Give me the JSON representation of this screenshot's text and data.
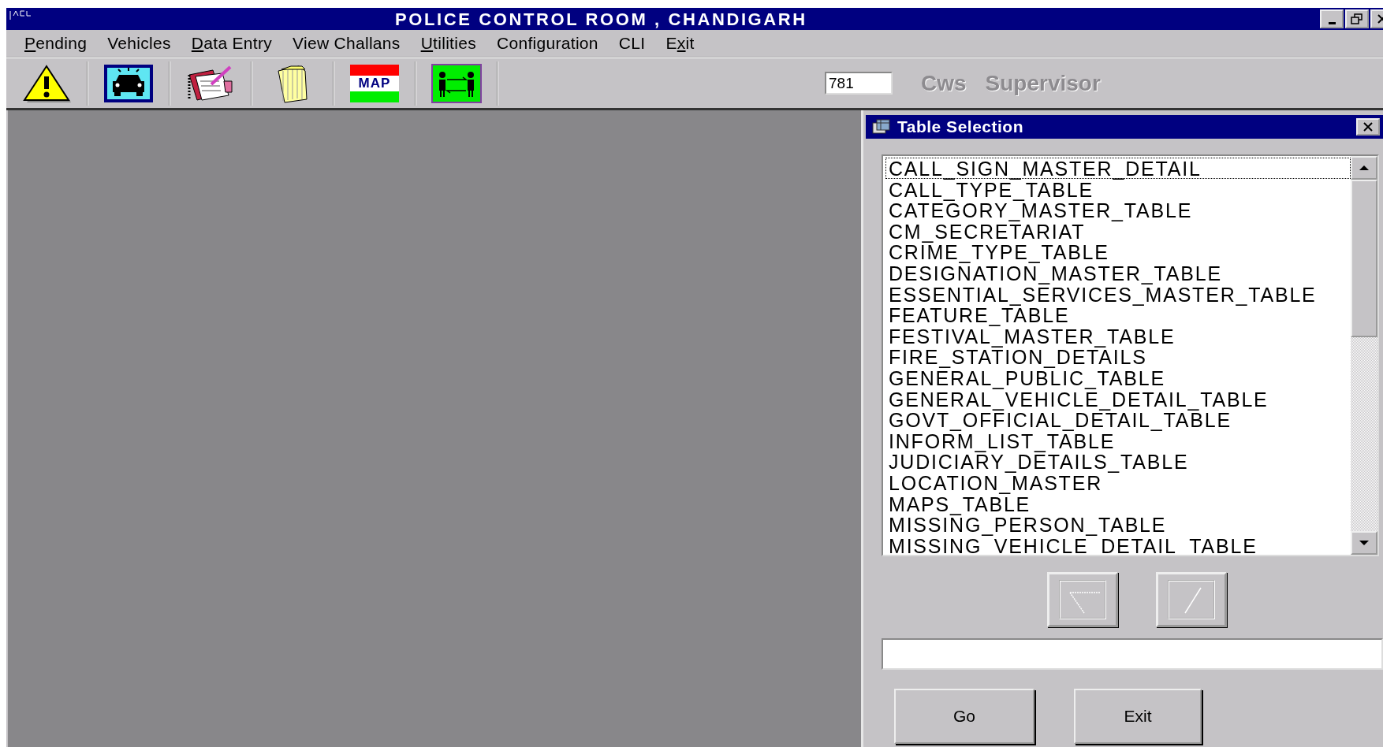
{
  "window": {
    "title": "POLICE CONTROL ROOM , CHANDIGARH"
  },
  "menu": [
    {
      "parts": [
        {
          "text": "P",
          "underlined": true
        },
        {
          "text": "ending",
          "underlined": false
        }
      ]
    },
    {
      "parts": [
        {
          "text": "Vehicles",
          "underlined": false
        }
      ]
    },
    {
      "parts": [
        {
          "text": "D",
          "underlined": true
        },
        {
          "text": "ata Entry",
          "underlined": false
        }
      ]
    },
    {
      "parts": [
        {
          "text": "View Challans",
          "underlined": false
        }
      ]
    },
    {
      "parts": [
        {
          "text": "U",
          "underlined": true
        },
        {
          "text": "tilities",
          "underlined": false
        }
      ]
    },
    {
      "parts": [
        {
          "text": "Configuration",
          "underlined": false
        }
      ]
    },
    {
      "parts": [
        {
          "text": "CLI",
          "underlined": false
        }
      ]
    },
    {
      "parts": [
        {
          "text": "E",
          "underlined": false
        },
        {
          "text": "x",
          "underlined": true
        },
        {
          "text": "it",
          "underlined": false
        }
      ]
    }
  ],
  "toolbar": {
    "buttons": [
      {
        "kind": "warning"
      },
      {
        "kind": "vehicle"
      },
      {
        "kind": "notebook"
      },
      {
        "kind": "files"
      },
      {
        "kind": "map",
        "label": "MAP"
      },
      {
        "kind": "transfer"
      }
    ],
    "code_field": {
      "value": "781"
    },
    "labels": [
      "Cws",
      "Supervisor"
    ]
  },
  "dialog": {
    "title": "Table Selection",
    "tables": [
      {
        "label": "CALL_SIGN_MASTER_DETAIL",
        "selected": true
      },
      {
        "label": "CALL_TYPE_TABLE",
        "selected": false
      },
      {
        "label": "CATEGORY_MASTER_TABLE",
        "selected": false
      },
      {
        "label": "CM_SECRETARIAT",
        "selected": false
      },
      {
        "label": "CRIME_TYPE_TABLE",
        "selected": false
      },
      {
        "label": "DESIGNATION_MASTER_TABLE",
        "selected": false
      },
      {
        "label": "ESSENTIAL_SERVICES_MASTER_TABLE",
        "selected": false
      },
      {
        "label": "FEATURE_TABLE",
        "selected": false
      },
      {
        "label": "FESTIVAL_MASTER_TABLE",
        "selected": false
      },
      {
        "label": "FIRE_STATION_DETAILS",
        "selected": false
      },
      {
        "label": "GENERAL_PUBLIC_TABLE",
        "selected": false
      },
      {
        "label": "GENERAL_VEHICLE_DETAIL_TABLE",
        "selected": false
      },
      {
        "label": "GOVT_OFFICIAL_DETAIL_TABLE",
        "selected": false
      },
      {
        "label": "INFORM_LIST_TABLE",
        "selected": false
      },
      {
        "label": "JUDICIARY_DETAILS_TABLE",
        "selected": false
      },
      {
        "label": "LOCATION_MASTER",
        "selected": false
      },
      {
        "label": "MAPS_TABLE",
        "selected": false
      },
      {
        "label": "MISSING_PERSON_TABLE",
        "selected": false
      },
      {
        "label": "MISSING_VEHICLE_DETAIL_TABLE",
        "selected": false
      }
    ],
    "buttons": [
      "Go",
      "Exit"
    ]
  }
}
